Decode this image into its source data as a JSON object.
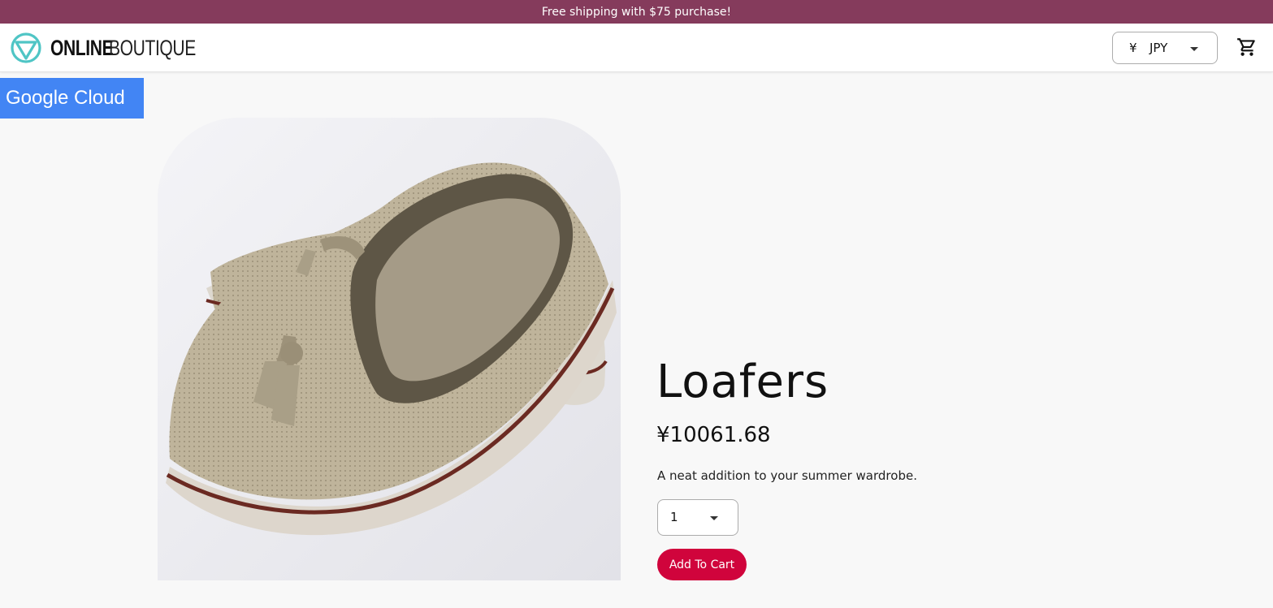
{
  "banner": {
    "text": "Free shipping with $75 purchase!"
  },
  "header": {
    "logo_bold": "ONLINE",
    "logo_light": "BOUTIQUE",
    "currency": {
      "symbol": "¥",
      "code": "JPY"
    }
  },
  "badge": {
    "text": "Google Cloud"
  },
  "product": {
    "name": "Loafers",
    "price": "¥10061.68",
    "description": "A neat addition to your summer wardrobe.",
    "quantity": "1",
    "add_to_cart_label": "Add To Cart"
  },
  "colors": {
    "banner_bg": "#853b5c",
    "accent_red": "#d0043c",
    "google_blue": "#4285f4",
    "logo_teal": "#4fc5c5"
  }
}
